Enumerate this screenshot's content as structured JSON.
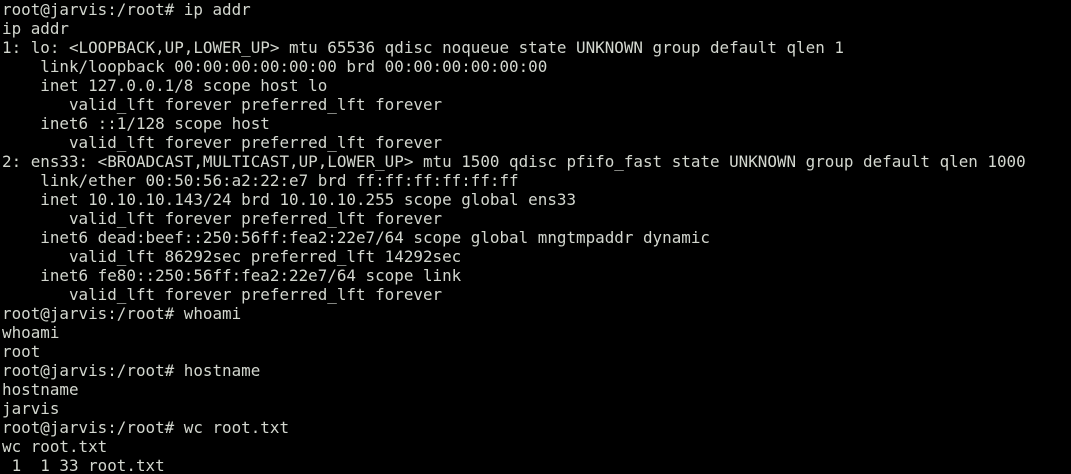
{
  "terminal": {
    "background": "#000000",
    "foreground": "#d3d7cf",
    "lines": [
      "root@jarvis:/root# ip addr",
      "ip addr",
      "1: lo: <LOOPBACK,UP,LOWER_UP> mtu 65536 qdisc noqueue state UNKNOWN group default qlen 1",
      "    link/loopback 00:00:00:00:00:00 brd 00:00:00:00:00:00",
      "    inet 127.0.0.1/8 scope host lo",
      "       valid_lft forever preferred_lft forever",
      "    inet6 ::1/128 scope host",
      "       valid_lft forever preferred_lft forever",
      "2: ens33: <BROADCAST,MULTICAST,UP,LOWER_UP> mtu 1500 qdisc pfifo_fast state UNKNOWN group default qlen 1000",
      "    link/ether 00:50:56:a2:22:e7 brd ff:ff:ff:ff:ff:ff",
      "    inet 10.10.10.143/24 brd 10.10.10.255 scope global ens33",
      "       valid_lft forever preferred_lft forever",
      "    inet6 dead:beef::250:56ff:fea2:22e7/64 scope global mngtmpaddr dynamic",
      "       valid_lft 86292sec preferred_lft 14292sec",
      "    inet6 fe80::250:56ff:fea2:22e7/64 scope link",
      "       valid_lft forever preferred_lft forever",
      "root@jarvis:/root# whoami",
      "whoami",
      "root",
      "root@jarvis:/root# hostname",
      "hostname",
      "jarvis",
      "root@jarvis:/root# wc root.txt",
      "wc root.txt",
      " 1  1 33 root.txt"
    ]
  }
}
